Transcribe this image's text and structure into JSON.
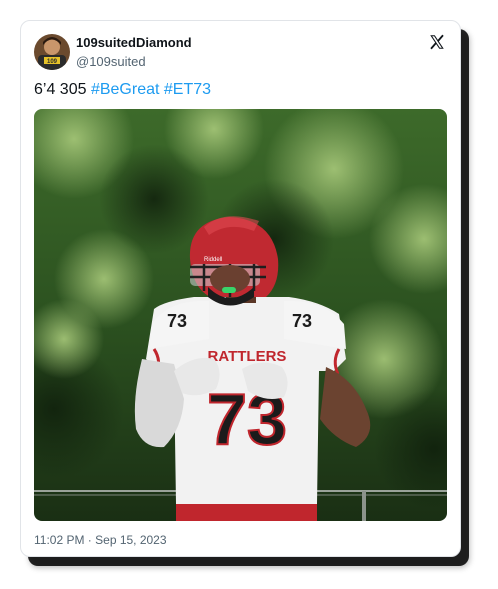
{
  "tweet": {
    "display_name": "109suitedDiamond",
    "handle": "@109suited",
    "text_plain": "6’4 305",
    "hashtags": [
      "#BeGreat",
      "#ET73"
    ],
    "timestamp": "11:02 PM · Sep 15, 2023",
    "hashtag_color": "#1d9bf0"
  },
  "avatar": {
    "badge_text": "109"
  },
  "photo": {
    "jersey_number": "73",
    "jersey_chest_text": "RATTLERS",
    "helmet_decal": "Riddell"
  },
  "icons": {
    "platform_logo": "x-logo-icon"
  }
}
